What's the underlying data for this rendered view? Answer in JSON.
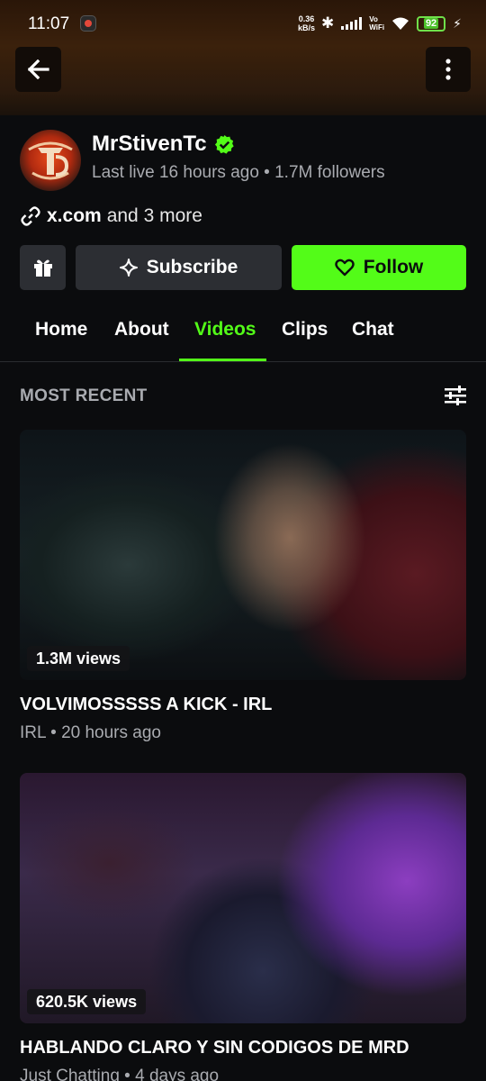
{
  "status_bar": {
    "time": "11:07",
    "speed_value": "0.36",
    "speed_unit": "kB/s",
    "vo": "Vo",
    "wifi_label": "WiFi",
    "battery": "92"
  },
  "colors": {
    "accent": "#53fc18",
    "background": "#0b0c0e",
    "button": "#2c2e33",
    "muted_text": "#a9abb0"
  },
  "channel": {
    "name": "MrStivenTc",
    "meta": "Last live 16 hours ago • 1.7M followers",
    "link_main": "x.com",
    "link_more": "and 3 more"
  },
  "actions": {
    "subscribe_label": "Subscribe",
    "follow_label": "Follow"
  },
  "tabs": [
    {
      "label": "Home"
    },
    {
      "label": "About"
    },
    {
      "label": "Videos",
      "active": true
    },
    {
      "label": "Clips"
    },
    {
      "label": "Chat"
    }
  ],
  "section": {
    "title": "MOST RECENT"
  },
  "videos": [
    {
      "title": "VOLVIMOSSSSS A KICK - IRL",
      "meta": "IRL • 20 hours ago",
      "views": "1.3M views"
    },
    {
      "title": "HABLANDO CLARO Y SIN CODIGOS DE MRD",
      "meta": "Just Chatting • 4 days ago",
      "views": "620.5K views"
    }
  ]
}
